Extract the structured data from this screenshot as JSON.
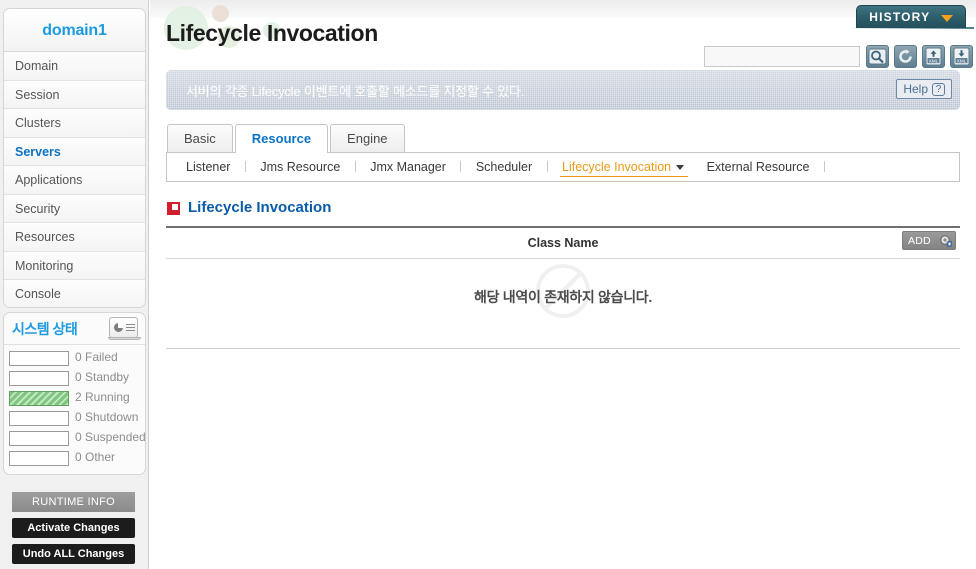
{
  "sidebar": {
    "domain_title": "domain1",
    "nav_items": [
      {
        "label": "Domain",
        "active": false
      },
      {
        "label": "Session",
        "active": false
      },
      {
        "label": "Clusters",
        "active": false
      },
      {
        "label": "Servers",
        "active": true
      },
      {
        "label": "Applications",
        "active": false
      },
      {
        "label": "Security",
        "active": false
      },
      {
        "label": "Resources",
        "active": false
      },
      {
        "label": "Monitoring",
        "active": false
      },
      {
        "label": "Console",
        "active": false
      }
    ],
    "status_panel": {
      "title": "시스템 상태",
      "icon": "monitor-chart-icon",
      "rows": [
        {
          "count": "0",
          "label": "Failed",
          "filled": false
        },
        {
          "count": "0",
          "label": "Standby",
          "filled": false
        },
        {
          "count": "2",
          "label": "Running",
          "filled": true
        },
        {
          "count": "0",
          "label": "Shutdown",
          "filled": false
        },
        {
          "count": "0",
          "label": "Suspended",
          "filled": false
        },
        {
          "count": "0",
          "label": "Other",
          "filled": false
        }
      ],
      "fill_color": "#7fc77f"
    },
    "buttons": {
      "runtime_info": "RUNTIME INFO",
      "activate_changes": "Activate Changes",
      "undo_all_changes": "Undo ALL Changes"
    }
  },
  "header": {
    "page_title": "Lifecycle Invocation",
    "history_button": "HISTORY",
    "history_caret_color": "#f2a01e",
    "search_value": "",
    "search_placeholder": "",
    "toolbar_icons": [
      "search-icon",
      "refresh-icon",
      "xml-export-icon",
      "xml-import-icon"
    ]
  },
  "banner": {
    "text": "서버의 각종 Lifecycle 이벤트에 호출할 메소드를 지정할 수 있다.",
    "help_label": "Help",
    "help_icon": "question-mark-icon"
  },
  "tabs": [
    {
      "label": "Basic",
      "active": false
    },
    {
      "label": "Resource",
      "active": true
    },
    {
      "label": "Engine",
      "active": false
    }
  ],
  "subtabs": [
    {
      "label": "Listener",
      "active": false
    },
    {
      "label": "Jms Resource",
      "active": false
    },
    {
      "label": "Jmx Manager",
      "active": false
    },
    {
      "label": "Scheduler",
      "active": false
    },
    {
      "label": "Lifecycle Invocation",
      "active": true
    },
    {
      "label": "External Resource",
      "active": false
    }
  ],
  "section": {
    "title": "Lifecycle Invocation",
    "icon": "red-square-icon",
    "accent_color": "#d0202e"
  },
  "table": {
    "columns": [
      "Class Name"
    ],
    "rows": [],
    "add_button_label": "ADD",
    "add_button_icon": "add-gear-icon",
    "empty_message": "해당 내역이 존재하지 않습니다.",
    "empty_icon": "no-entry-watermark-icon"
  }
}
